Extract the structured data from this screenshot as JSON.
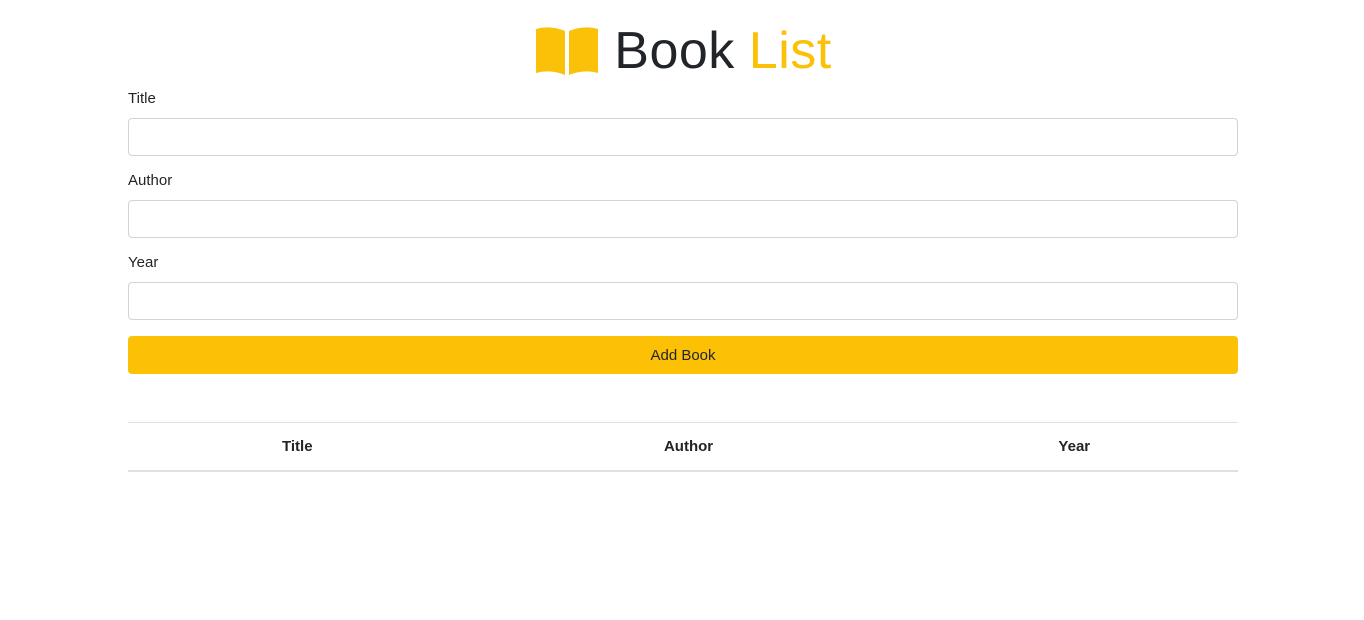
{
  "header": {
    "title_part1": "Book",
    "title_part2": "List",
    "icon": "book-open-icon",
    "accent_color": "#fbc108"
  },
  "form": {
    "title_label": "Title",
    "title_value": "",
    "author_label": "Author",
    "author_value": "",
    "year_label": "Year",
    "year_value": "",
    "submit_label": "Add Book"
  },
  "table": {
    "columns": [
      "Title",
      "Author",
      "Year"
    ],
    "rows": []
  }
}
